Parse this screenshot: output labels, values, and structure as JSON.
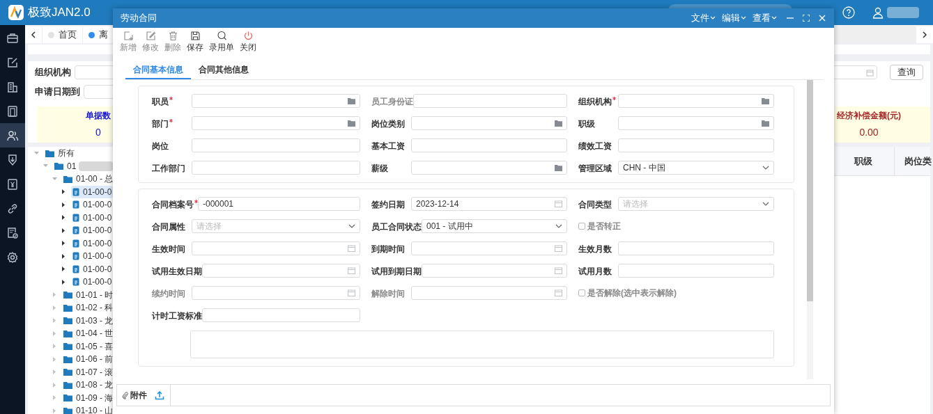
{
  "app": {
    "title": "极致JAN2.0",
    "nav": [
      {
        "selected": false
      },
      {
        "selected": false
      },
      {
        "selected": false
      },
      {
        "selected": false
      },
      {
        "selected": true
      },
      {
        "selected": false
      },
      {
        "selected": false
      },
      {
        "selected": false
      },
      {
        "selected": false
      },
      {
        "selected": false
      }
    ],
    "tabs": [
      {
        "label": "首页",
        "selected": false
      },
      {
        "label": "离",
        "selected": true
      }
    ],
    "filters": {
      "org_label": "组织机构",
      "date_to_label": "申请日期到",
      "query_button": "查询"
    },
    "summary": [
      {
        "label": "单据数",
        "value": "0",
        "kind": "count"
      },
      {
        "label": "经济补偿金额(元)",
        "value": "0.00",
        "kind": "amount"
      }
    ],
    "grid_columns": [
      "职级",
      "岗位类"
    ],
    "tree": {
      "label": "所有",
      "kind": "folder",
      "expanded": true,
      "selected": false,
      "children": [
        {
          "label": "01",
          "kind": "folder",
          "expanded": true,
          "selected": false,
          "blurred": true,
          "children": [
            {
              "label": "01-00 - 总",
              "kind": "folder",
              "expanded": true,
              "selected": false,
              "children": [
                {
                  "label": "01-00-0",
                  "kind": "doc",
                  "expanded": false,
                  "selected": true
                },
                {
                  "label": "01-00-0",
                  "kind": "doc",
                  "expanded": false,
                  "selected": false
                },
                {
                  "label": "01-00-0",
                  "kind": "doc",
                  "expanded": false,
                  "selected": false
                },
                {
                  "label": "01-00-0",
                  "kind": "doc",
                  "expanded": false,
                  "selected": false
                },
                {
                  "label": "01-00-0",
                  "kind": "doc",
                  "expanded": false,
                  "selected": false
                },
                {
                  "label": "01-00-0",
                  "kind": "doc",
                  "expanded": false,
                  "selected": false
                },
                {
                  "label": "01-00-0",
                  "kind": "doc",
                  "expanded": false,
                  "selected": false
                },
                {
                  "label": "01-00-0",
                  "kind": "doc",
                  "expanded": false,
                  "selected": false
                }
              ]
            },
            {
              "label": "01-01 - 时",
              "kind": "folder",
              "expanded": false,
              "selected": false
            },
            {
              "label": "01-02 - 科",
              "kind": "folder",
              "expanded": false,
              "selected": false
            },
            {
              "label": "01-03 - 龙",
              "kind": "folder",
              "expanded": false,
              "selected": false
            },
            {
              "label": "01-04 - 世",
              "kind": "folder",
              "expanded": false,
              "selected": false
            },
            {
              "label": "01-05 - 喜",
              "kind": "folder",
              "expanded": false,
              "selected": false
            },
            {
              "label": "01-06 - 前",
              "kind": "folder",
              "expanded": false,
              "selected": false
            },
            {
              "label": "01-07 - 滚",
              "kind": "folder",
              "expanded": false,
              "selected": false
            },
            {
              "label": "01-08 - 龙",
              "kind": "folder",
              "expanded": false,
              "selected": false
            },
            {
              "label": "01-09 - 海",
              "kind": "folder",
              "expanded": false,
              "selected": false
            },
            {
              "label": "01-10 - 山",
              "kind": "folder",
              "expanded": false,
              "selected": false
            }
          ]
        }
      ]
    }
  },
  "dialog": {
    "title": "劳动合同",
    "menus": [
      "文件",
      "编辑",
      "查看"
    ],
    "toolbar": [
      {
        "label": "新增",
        "disabled": true
      },
      {
        "label": "修改",
        "disabled": true
      },
      {
        "label": "删除",
        "disabled": true
      },
      {
        "label": "保存",
        "disabled": false
      },
      {
        "label": "录用单",
        "disabled": false
      },
      {
        "label": "关闭",
        "disabled": false
      }
    ],
    "tabs": [
      {
        "label": "合同基本信息",
        "selected": true
      },
      {
        "label": "合同其他信息",
        "selected": false
      }
    ],
    "sections": [
      {
        "rows": [
          [
            {
              "label": "职员",
              "kind": "lookup",
              "required": true
            },
            {
              "label": "员工身份证",
              "kind": "text",
              "disabled": true
            },
            {
              "label": "组织机构",
              "kind": "lookup",
              "required": true
            }
          ],
          [
            {
              "label": "部门",
              "kind": "lookup",
              "required": true
            },
            {
              "label": "岗位类别",
              "kind": "lookup"
            },
            {
              "label": "职级",
              "kind": "lookup"
            }
          ],
          [
            {
              "label": "岗位",
              "kind": "text"
            },
            {
              "label": "基本工资",
              "kind": "text"
            },
            {
              "label": "绩效工资",
              "kind": "text"
            }
          ],
          [
            {
              "label": "工作部门",
              "kind": "text"
            },
            {
              "label": "薪级",
              "kind": "lookup"
            },
            {
              "label": "管理区域",
              "kind": "select",
              "value": "CHN - 中国"
            }
          ]
        ]
      },
      {
        "rows": [
          [
            {
              "label": "合同档案号",
              "kind": "text",
              "required": true,
              "value": "-000001"
            },
            {
              "label": "签约日期",
              "kind": "date",
              "value": "2023-12-14"
            },
            {
              "label": "合同类型",
              "kind": "select",
              "placeholder": "请选择"
            }
          ],
          [
            {
              "label": "合同属性",
              "kind": "select",
              "placeholder": "请选择"
            },
            {
              "label": "员工合同状态",
              "kind": "select",
              "value": "001 - 试用中"
            },
            {
              "label": "是否转正",
              "kind": "checkbox",
              "checked": false,
              "disabled": true
            }
          ],
          [
            {
              "label": "生效时间",
              "kind": "date"
            },
            {
              "label": "到期时间",
              "kind": "date"
            },
            {
              "label": "生效月数",
              "kind": "text"
            }
          ],
          [
            {
              "label": "试用生效日期",
              "kind": "date"
            },
            {
              "label": "试用到期日期",
              "kind": "date"
            },
            {
              "label": "试用月数",
              "kind": "text"
            }
          ],
          [
            {
              "label": "续约时间",
              "kind": "date",
              "disabled": true
            },
            {
              "label": "解除时间",
              "kind": "date",
              "disabled": true
            },
            {
              "label": "是否解除(选中表示解除)",
              "kind": "checkbox",
              "checked": false,
              "disabled": true
            }
          ],
          [
            {
              "label": "计时工资标准",
              "kind": "text"
            }
          ],
          [
            {
              "kind": "textarea"
            }
          ]
        ]
      }
    ],
    "attachments": {
      "label": "附件"
    }
  }
}
